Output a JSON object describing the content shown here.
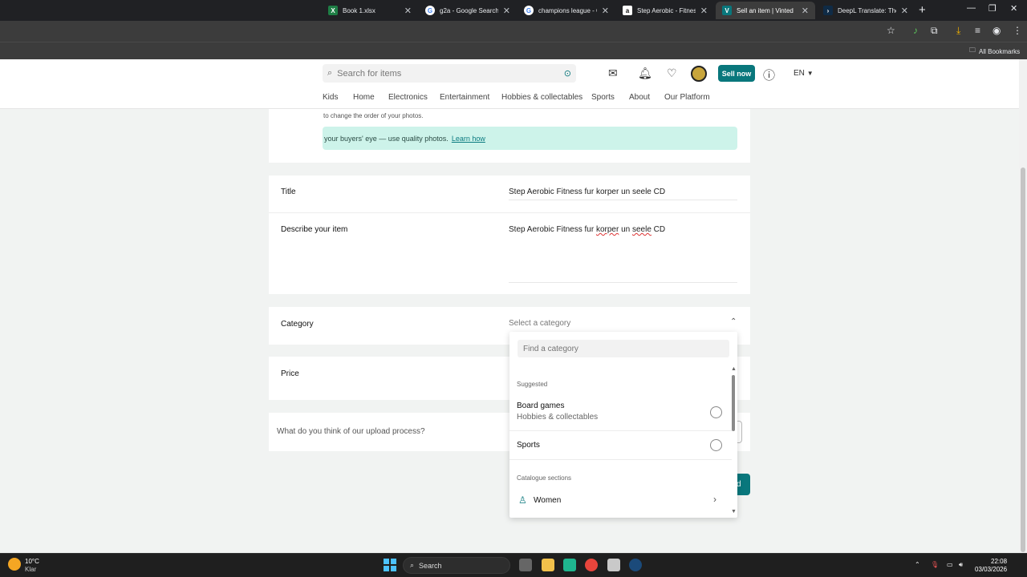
{
  "browser": {
    "tabs": [
      {
        "title": "Book 1.xlsx",
        "icon": "excel-icon",
        "color": "#1e7e45",
        "active": false
      },
      {
        "title": "g2a - Google Search",
        "icon": "google-icon",
        "color": "#ffffff",
        "active": false
      },
      {
        "title": "champions league - Go",
        "icon": "google-icon",
        "color": "#ffffff",
        "active": false
      },
      {
        "title": "Step Aerobic - Fitness f",
        "icon": "amazon-icon",
        "color": "#ffffff",
        "active": false
      },
      {
        "title": "Sell an item | Vinted",
        "icon": "vinted-icon",
        "color": "#09777c",
        "active": true
      },
      {
        "title": "DeepL Translate: The w",
        "icon": "deepl-icon",
        "color": "#0f2b46",
        "active": false
      }
    ],
    "bookmarks_label": "All Bookmarks"
  },
  "header": {
    "search_placeholder": "Search for items",
    "sell_now": "Sell now",
    "language": "EN",
    "nav": [
      "Kids",
      "Home",
      "Electronics",
      "Entertainment",
      "Hobbies & collectables",
      "Sports",
      "About",
      "Our Platform"
    ]
  },
  "photos": {
    "hint": "to change the order of your photos.",
    "tip_text": "your buyers' eye — use quality photos.",
    "tip_link": "Learn how"
  },
  "form": {
    "title_label": "Title",
    "title_value": "Step Aerobic Fitness fur korper un seele CD",
    "describe_label": "Describe your item",
    "describe_pre": "Step Aerobic Fitness fur ",
    "describe_w1": "korper",
    "describe_mid": " un ",
    "describe_w2": "seele",
    "describe_post": " CD",
    "category_label": "Category",
    "category_placeholder": "Select a category",
    "price_label": "Price",
    "feedback_question": "What do you think of our upload process?",
    "upload_btn_partial": "d"
  },
  "dropdown": {
    "find_placeholder": "Find a category",
    "suggested_heading": "Suggested",
    "suggestions": [
      {
        "title": "Board games",
        "subtitle": "Hobbies & collectables"
      },
      {
        "title": "Sports",
        "subtitle": ""
      }
    ],
    "catalogue_heading": "Catalogue sections",
    "sections": [
      {
        "title": "Women",
        "icon": "dress-icon"
      }
    ]
  },
  "taskbar": {
    "weather_temp": "10°C",
    "weather_desc": "Klar",
    "search_label": "Search",
    "time": "22:08",
    "date": "03/03/2026"
  },
  "colors": {
    "brand": "#09777c",
    "tip_bg": "#cdf3ea"
  }
}
